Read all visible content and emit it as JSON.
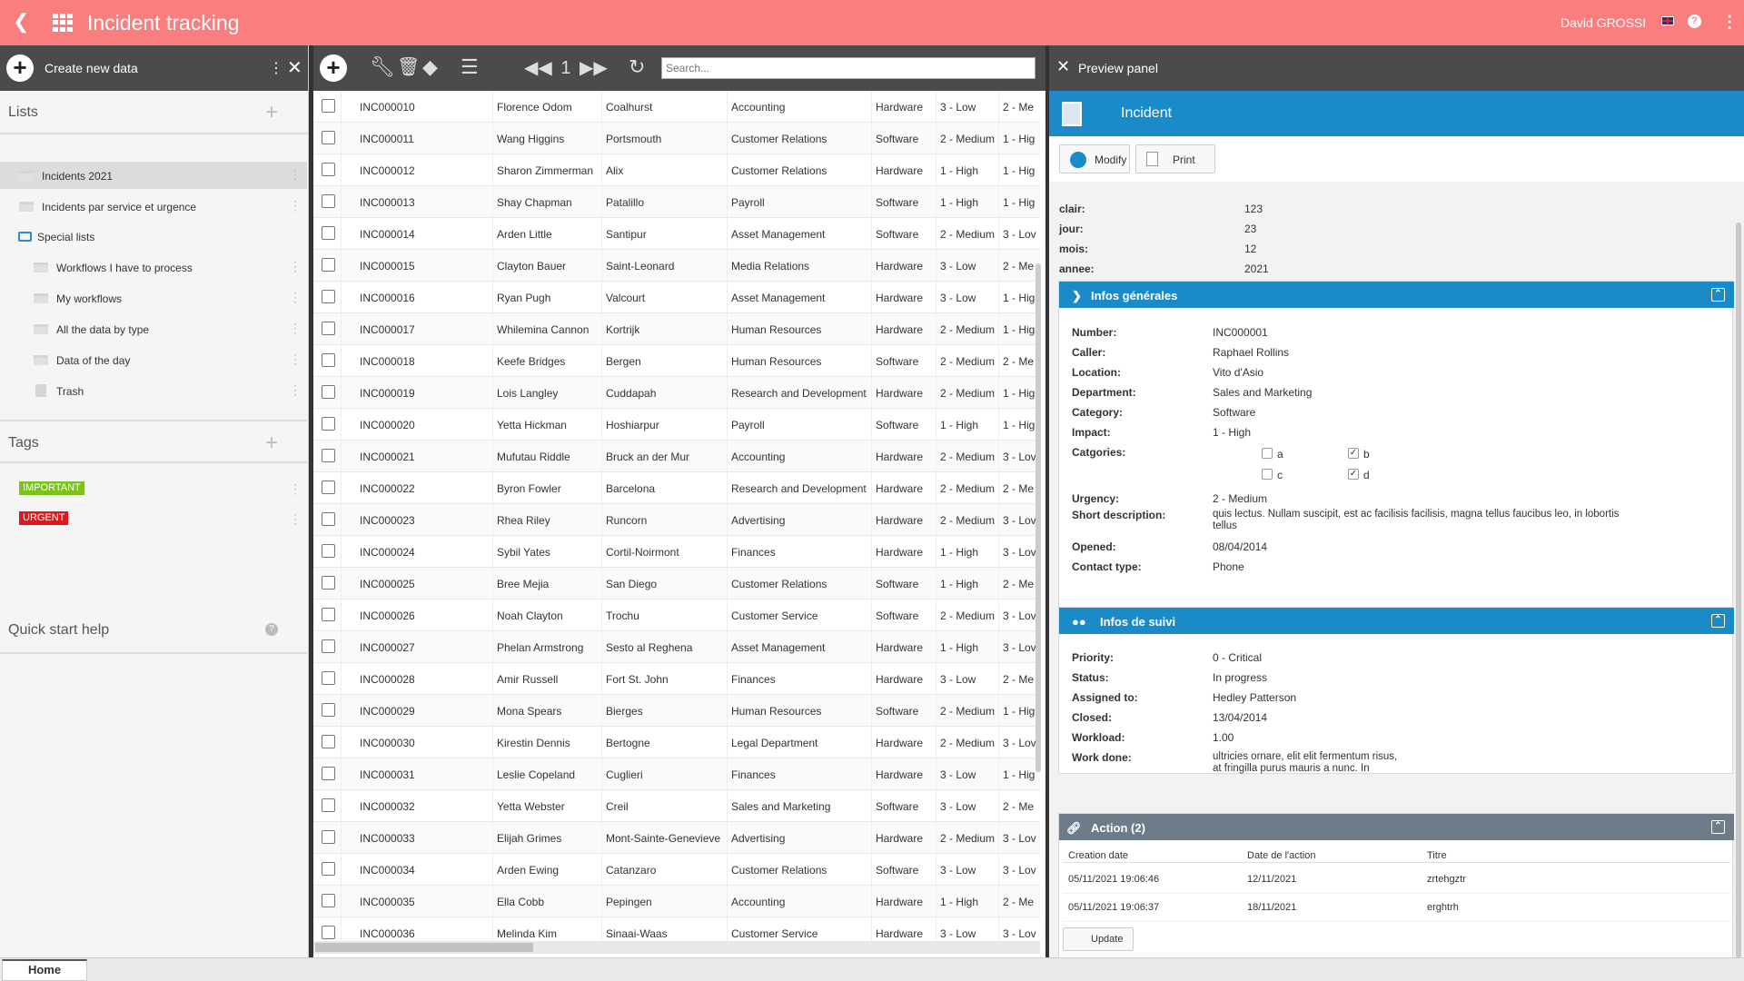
{
  "header": {
    "title": "Incident tracking",
    "user": "David GROSSI",
    "help": "?"
  },
  "left": {
    "create_label": "Create new data",
    "lists_title": "Lists",
    "lists": [
      {
        "label": "Incidents 2021",
        "selected": true
      },
      {
        "label": "Incidents par service et urgence"
      }
    ],
    "special_title": "Special lists",
    "special": [
      {
        "label": "Workflows I have to process"
      },
      {
        "label": "My workflows"
      },
      {
        "label": "All the data by type"
      },
      {
        "label": "Data of the day"
      },
      {
        "label": "Trash"
      }
    ],
    "tags_title": "Tags",
    "tags": [
      {
        "label": "IMPORTANT",
        "color": "#7cc21e"
      },
      {
        "label": "URGENT",
        "color": "#e5161b"
      }
    ],
    "quick_start": "Quick start help"
  },
  "toolbar": {
    "page": "1",
    "search_placeholder": "Search..."
  },
  "rows": [
    [
      "INC000010",
      "Florence Odom",
      "Coalhurst",
      "Accounting",
      "Hardware",
      "3 - Low",
      "2 - Me"
    ],
    [
      "INC000011",
      "Wang Higgins",
      "Portsmouth",
      "Customer Relations",
      "Software",
      "2 - Medium",
      "1 - Hig"
    ],
    [
      "INC000012",
      "Sharon Zimmerman",
      "Alix",
      "Customer Relations",
      "Hardware",
      "1 - High",
      "1 - Hig"
    ],
    [
      "INC000013",
      "Shay Chapman",
      "Patalillo",
      "Payroll",
      "Software",
      "1 - High",
      "1 - Hig"
    ],
    [
      "INC000014",
      "Arden Little",
      "Santipur",
      "Asset Management",
      "Software",
      "2 - Medium",
      "3 - Lov"
    ],
    [
      "INC000015",
      "Clayton Bauer",
      "Saint-Leonard",
      "Media Relations",
      "Hardware",
      "3 - Low",
      "2 - Me"
    ],
    [
      "INC000016",
      "Ryan Pugh",
      "Valcourt",
      "Asset Management",
      "Hardware",
      "3 - Low",
      "1 - Hig"
    ],
    [
      "INC000017",
      "Whilemina Cannon",
      "Kortrijk",
      "Human Resources",
      "Hardware",
      "2 - Medium",
      "1 - Hig"
    ],
    [
      "INC000018",
      "Keefe Bridges",
      "Bergen",
      "Human Resources",
      "Software",
      "2 - Medium",
      "2 - Me"
    ],
    [
      "INC000019",
      "Lois Langley",
      "Cuddapah",
      "Research and Development",
      "Hardware",
      "2 - Medium",
      "1 - Hig"
    ],
    [
      "INC000020",
      "Yetta Hickman",
      "Hoshiarpur",
      "Payroll",
      "Software",
      "1 - High",
      "1 - Hig"
    ],
    [
      "INC000021",
      "Mufutau Riddle",
      "Bruck an der Mur",
      "Accounting",
      "Hardware",
      "2 - Medium",
      "3 - Lov"
    ],
    [
      "INC000022",
      "Byron Fowler",
      "Barcelona",
      "Research and Development",
      "Hardware",
      "2 - Medium",
      "2 - Me"
    ],
    [
      "INC000023",
      "Rhea Riley",
      "Runcorn",
      "Advertising",
      "Hardware",
      "2 - Medium",
      "3 - Lov"
    ],
    [
      "INC000024",
      "Sybil Yates",
      "Cortil-Noirmont",
      "Finances",
      "Hardware",
      "1 - High",
      "3 - Lov"
    ],
    [
      "INC000025",
      "Bree Mejia",
      "San Diego",
      "Customer Relations",
      "Software",
      "1 - High",
      "2 - Me"
    ],
    [
      "INC000026",
      "Noah Clayton",
      "Trochu",
      "Customer Service",
      "Software",
      "2 - Medium",
      "3 - Lov"
    ],
    [
      "INC000027",
      "Phelan Armstrong",
      "Sesto al Reghena",
      "Asset Management",
      "Hardware",
      "1 - High",
      "3 - Lov"
    ],
    [
      "INC000028",
      "Amir Russell",
      "Fort St. John",
      "Finances",
      "Hardware",
      "3 - Low",
      "2 - Me"
    ],
    [
      "INC000029",
      "Mona Spears",
      "Bierges",
      "Human Resources",
      "Software",
      "2 - Medium",
      "1 - Hig"
    ],
    [
      "INC000030",
      "Kirestin Dennis",
      "Bertogne",
      "Legal Department",
      "Hardware",
      "2 - Medium",
      "3 - Lov"
    ],
    [
      "INC000031",
      "Leslie Copeland",
      "Cuglieri",
      "Finances",
      "Hardware",
      "3 - Low",
      "1 - Hig"
    ],
    [
      "INC000032",
      "Yetta Webster",
      "Creil",
      "Sales and Marketing",
      "Software",
      "3 - Low",
      "2 - Me"
    ],
    [
      "INC000033",
      "Elijah Grimes",
      "Mont-Sainte-Genevieve",
      "Advertising",
      "Hardware",
      "2 - Medium",
      "3 - Lov"
    ],
    [
      "INC000034",
      "Arden Ewing",
      "Catanzaro",
      "Customer Relations",
      "Software",
      "3 - Low",
      "3 - Lov"
    ],
    [
      "INC000035",
      "Ella Cobb",
      "Pepingen",
      "Accounting",
      "Hardware",
      "1 - High",
      "2 - Me"
    ],
    [
      "INC000036",
      "Melinda Kim",
      "Sinaai-Waas",
      "Customer Service",
      "Hardware",
      "3 - Low",
      "3 - Lov"
    ]
  ],
  "preview": {
    "title": "Preview panel",
    "record_type": "Incident",
    "modify_label": "Modify",
    "print_label": "Print",
    "top_fields": [
      {
        "k": "clair:",
        "v": "123"
      },
      {
        "k": "jour:",
        "v": "23"
      },
      {
        "k": "mois:",
        "v": "12"
      },
      {
        "k": "annee:",
        "v": "2021"
      }
    ],
    "general_title": "Infos générales",
    "general_a": [
      {
        "k": "Number:",
        "v": "INC000001"
      },
      {
        "k": "Caller:",
        "v": "Raphael Rollins"
      },
      {
        "k": "Location:",
        "v": "Vito d'Asio"
      },
      {
        "k": "Department:",
        "v": "Sales and Marketing"
      },
      {
        "k": "Category:",
        "v": "Software"
      },
      {
        "k": "Impact:",
        "v": "1 - High"
      }
    ],
    "categories_label": "Catgories:",
    "categories": [
      {
        "label": "a",
        "checked": false
      },
      {
        "label": "b",
        "checked": true
      },
      {
        "label": "c",
        "checked": false
      },
      {
        "label": "d",
        "checked": true
      }
    ],
    "urgency_k": "Urgency:",
    "urgency_v": "2 - Medium",
    "shortdesc_k": "Short description:",
    "shortdesc_v1": "quis lectus. Nullam suscipit, est ac facilisis facilisis, magna tellus faucibus leo, in lobortis",
    "shortdesc_v2": "tellus",
    "opened_k": "Opened:",
    "opened_v": "08/04/2014",
    "contact_k": "Contact type:",
    "contact_v": "Phone",
    "followup_title": "Infos de suivi",
    "followup": [
      {
        "k": "Priority:",
        "v": "0 - Critical"
      },
      {
        "k": "Status:",
        "v": "In progress"
      },
      {
        "k": "Assigned to:",
        "v": "Hedley Patterson"
      },
      {
        "k": "Closed:",
        "v": "13/04/2014"
      },
      {
        "k": "Workload:",
        "v": "1.00"
      }
    ],
    "workdone_k": "Work done:",
    "workdone_v1": "ultricies ornare, elit elit fermentum risus,",
    "workdone_v2": "at fringilla purus mauris a nunc. In",
    "action_title": "Action (2)",
    "action_cols": [
      "Creation date",
      "Date de l'action",
      "Titre"
    ],
    "action_rows": [
      [
        "05/11/2021 19:06:46",
        "12/11/2021",
        "zrtehgztr"
      ],
      [
        "05/11/2021 19:06:37",
        "18/11/2021",
        "erghtrh"
      ]
    ],
    "update_label": "Update"
  },
  "bottom": {
    "home_tab": "Home"
  }
}
